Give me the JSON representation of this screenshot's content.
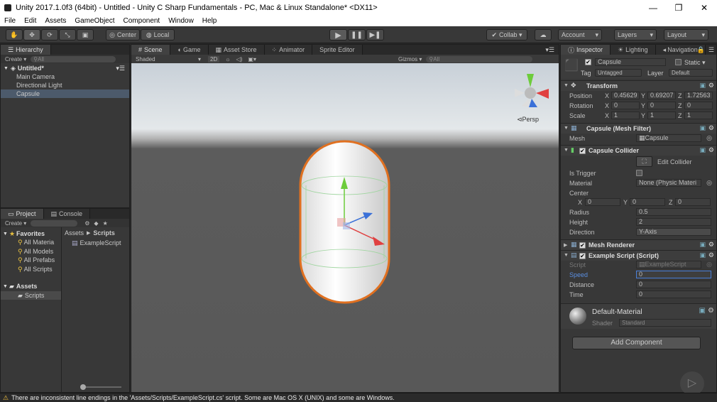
{
  "window": {
    "title": "Unity 2017.1.0f3 (64bit) - Untitled - Unity C Sharp Fundamentals - PC, Mac & Linux Standalone* <DX11>",
    "minimize": "—",
    "maximize": "❐",
    "close": "✕"
  },
  "menu": [
    "File",
    "Edit",
    "Assets",
    "GameObject",
    "Component",
    "Window",
    "Help"
  ],
  "toolbar": {
    "pivot_center": "Center",
    "pivot_local": "Local",
    "collab": "Collab ▾",
    "account": "Account",
    "layers": "Layers",
    "layout": "Layout"
  },
  "hierarchy": {
    "tab": "Hierarchy",
    "create": "Create ▾",
    "search": "All",
    "scene": "Untitled*",
    "items": [
      "Main Camera",
      "Directional Light",
      "Capsule"
    ],
    "selected": "Capsule"
  },
  "scene": {
    "tabs": [
      "Scene",
      "Game",
      "Asset Store",
      "Animator",
      "Sprite Editor"
    ],
    "shading": "Shaded",
    "mode_2d": "2D",
    "gizmos": "Gizmos ▾",
    "search": "All",
    "persp": "Persp"
  },
  "project": {
    "tabs": [
      "Project",
      "Console"
    ],
    "create": "Create ▾",
    "favorites": "Favorites",
    "fav_items": [
      "All Materia",
      "All Models",
      "All Prefabs",
      "All Scripts"
    ],
    "assets": "Assets",
    "asset_folders": [
      "Scripts"
    ],
    "breadcrumb": [
      "Assets",
      "Scripts"
    ],
    "files": [
      "ExampleScript"
    ]
  },
  "inspector": {
    "tabs": [
      "Inspector",
      "Lighting",
      "Navigation"
    ],
    "object_name": "Capsule",
    "static": "Static ▾",
    "tag_label": "Tag",
    "tag_value": "Untagged",
    "layer_label": "Layer",
    "layer_value": "Default",
    "transform": {
      "title": "Transform",
      "rows": [
        {
          "label": "Position",
          "x": "0.45629",
          "y": "0.69207",
          "z": "1.72563"
        },
        {
          "label": "Rotation",
          "x": "0",
          "y": "0",
          "z": "0"
        },
        {
          "label": "Scale",
          "x": "1",
          "y": "1",
          "z": "1"
        }
      ]
    },
    "mesh_filter": {
      "title": "Capsule (Mesh Filter)",
      "mesh_label": "Mesh",
      "mesh_value": "Capsule"
    },
    "collider": {
      "title": "Capsule Collider",
      "edit": "Edit Collider",
      "is_trigger": "Is Trigger",
      "material_label": "Material",
      "material_value": "None (Physic Materi",
      "center_label": "Center",
      "cx": "0",
      "cy": "0",
      "cz": "0",
      "radius_label": "Radius",
      "radius": "0.5",
      "height_label": "Height",
      "height": "2",
      "direction_label": "Direction",
      "direction": "Y-Axis"
    },
    "mesh_renderer": {
      "title": "Mesh Renderer"
    },
    "script": {
      "title": "Example Script (Script)",
      "script_label": "Script",
      "script_value": "ExampleScript",
      "speed_label": "Speed",
      "speed": "0",
      "distance_label": "Distance",
      "distance": "0",
      "time_label": "Time",
      "time": "0"
    },
    "material": {
      "name": "Default-Material",
      "shader_label": "Shader",
      "shader": "Standard"
    },
    "add_component": "Add Component"
  },
  "status": {
    "message": "There are inconsistent line endings in the 'Assets/Scripts/ExampleScript.cs' script. Some are Mac OS X (UNIX) and some are Windows."
  }
}
